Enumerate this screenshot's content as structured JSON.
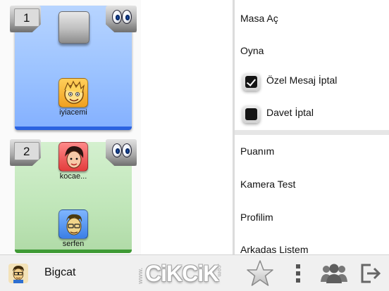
{
  "tables": [
    {
      "number": "1",
      "color": "#9cc3ff",
      "players": [
        {
          "name": "iyiacemi",
          "avatar": "cartoon-face-orange"
        }
      ]
    },
    {
      "number": "2",
      "color": "#c0e6b9",
      "players": [
        {
          "name": "kocae...",
          "avatar": "cartoon-face-red"
        },
        {
          "name": "serfen",
          "avatar": "cartoon-face-blue"
        }
      ]
    }
  ],
  "menu": {
    "open_table": "Masa Aç",
    "play": "Oyna",
    "private_msg_cancel": {
      "label": "Özel Mesaj İptal",
      "checked": true
    },
    "invite_cancel": {
      "label": "Davet İptal",
      "checked": false
    },
    "my_score": "Puanım",
    "camera_test": "Kamera Test",
    "my_profile": "Profilim",
    "friends_list": "Arkadas Listem"
  },
  "bottombar": {
    "username": "Bigcat",
    "logo": {
      "prefix": "www.",
      "main": "CiKCiK",
      "suffix": ".com"
    },
    "icons": [
      "star-icon",
      "more-vertical-icon",
      "users-icon",
      "exit-icon"
    ]
  }
}
